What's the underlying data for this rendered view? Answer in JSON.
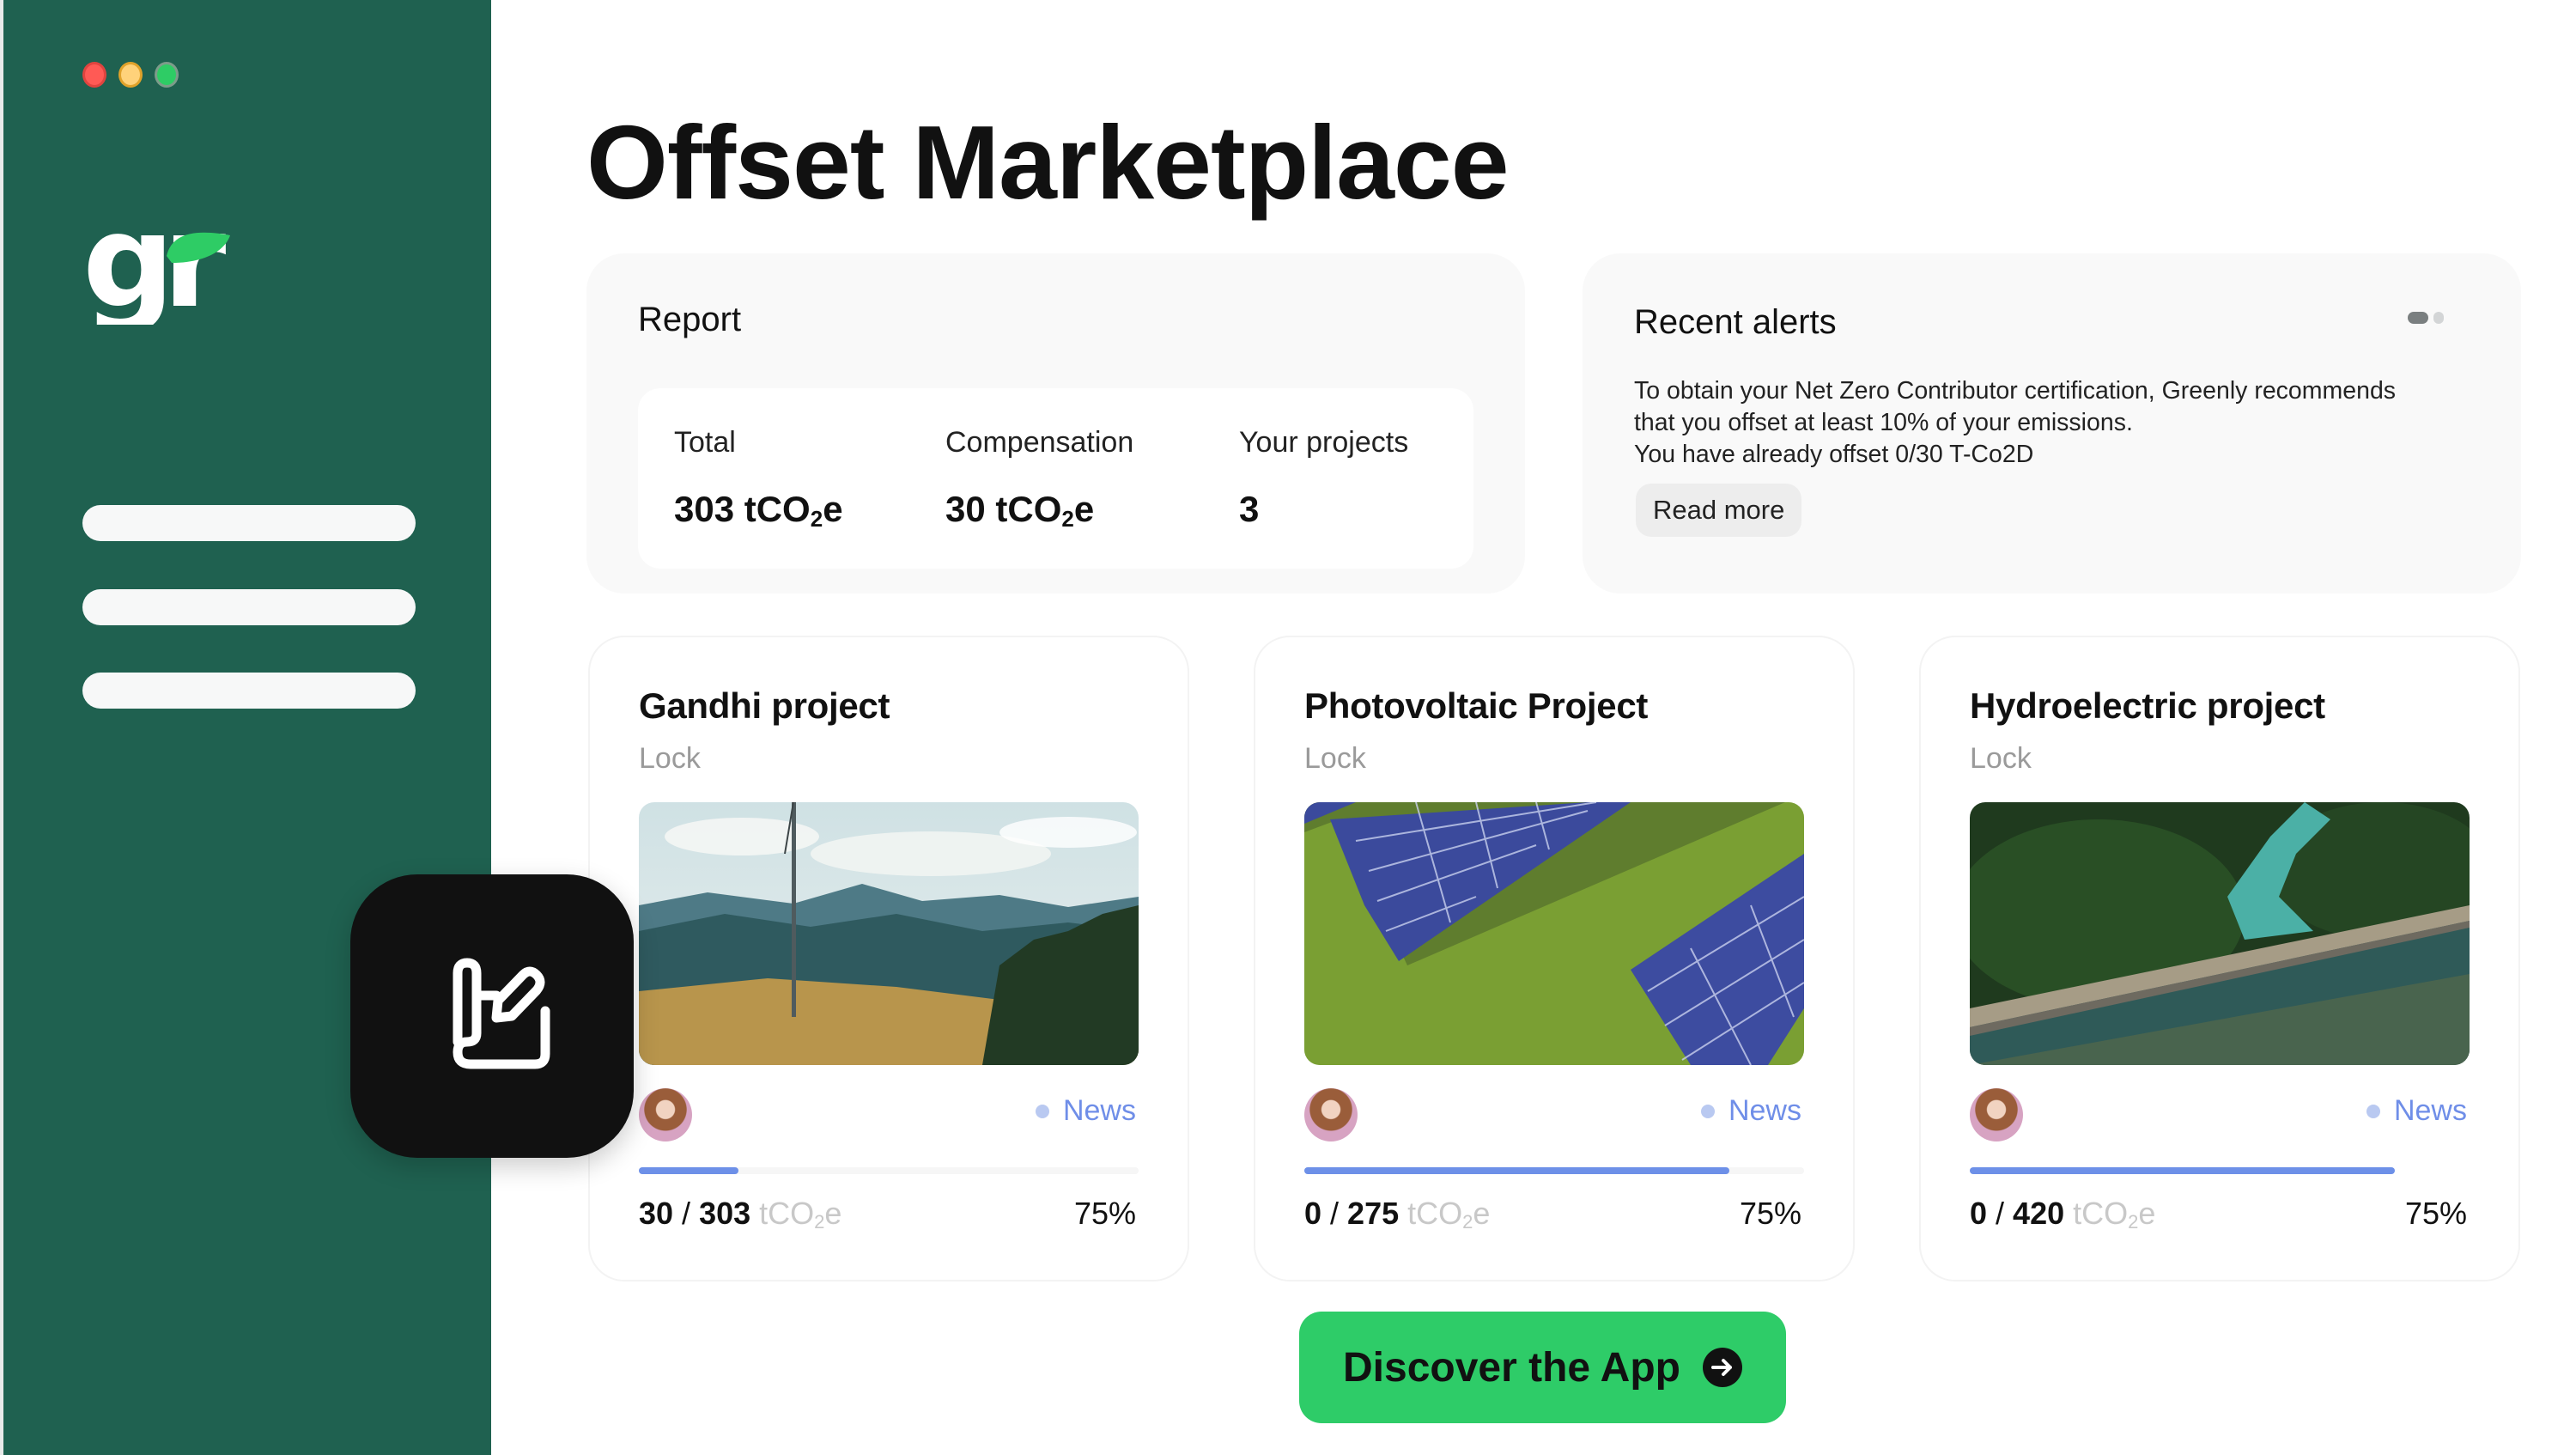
{
  "window": {
    "traffic_lights": [
      "close",
      "minimize",
      "maximize"
    ]
  },
  "sidebar": {
    "logo_text": "gr",
    "brand_color": "#1f6150",
    "leaf_color": "#2ecc65",
    "nav_items": [
      {
        "label": ""
      },
      {
        "label": ""
      },
      {
        "label": ""
      }
    ]
  },
  "page": {
    "title": "Offset Marketplace"
  },
  "report": {
    "title": "Report",
    "stats": [
      {
        "label": "Total",
        "value": "303 tCO",
        "sub": "2",
        "suffix": "e"
      },
      {
        "label": "Compensation",
        "value": "30 tCO",
        "sub": "2",
        "suffix": "e"
      },
      {
        "label": "Your projects",
        "value": "3",
        "sub": "",
        "suffix": ""
      }
    ]
  },
  "alerts": {
    "title": "Recent alerts",
    "carousel": {
      "count": 2,
      "active_index": 0
    },
    "lines": [
      "To obtain your Net Zero Contributor certification, Greenly recommends",
      "that you offset at least 10% of your emissions.",
      "You have already offset 0/30 T-Co2D"
    ],
    "read_more_label": "Read more"
  },
  "projects": [
    {
      "title": "Gandhi project",
      "status": "Lock",
      "image": "wind-turbine-landscape",
      "tag": "News",
      "current": "30",
      "target": "303",
      "unit": "tCO",
      "unit_sub": "2",
      "unit_suffix": "e",
      "percent_label": "75%",
      "progress": 0.2,
      "track_visible": true
    },
    {
      "title": "Photovoltaic Project",
      "status": "Lock",
      "image": "solar-panels-field",
      "tag": "News",
      "current": "0",
      "target": "275",
      "unit": "tCO",
      "unit_sub": "2",
      "unit_suffix": "e",
      "percent_label": "75%",
      "progress": 0.85,
      "track_visible": true
    },
    {
      "title": "Hydroelectric project",
      "status": "Lock",
      "image": "dam-river-forest",
      "tag": "News",
      "current": "0",
      "target": "420",
      "unit": "tCO",
      "unit_sub": "2",
      "unit_suffix": "e",
      "percent_label": "75%",
      "progress": 0.85,
      "track_visible": false
    }
  ],
  "app_icon": {
    "name": "edit-document-icon"
  },
  "cta": {
    "label": "Discover the App",
    "color": "#2ecc68"
  },
  "accent": {
    "progress": "#6d90e8",
    "news": "#6f8ee8"
  }
}
